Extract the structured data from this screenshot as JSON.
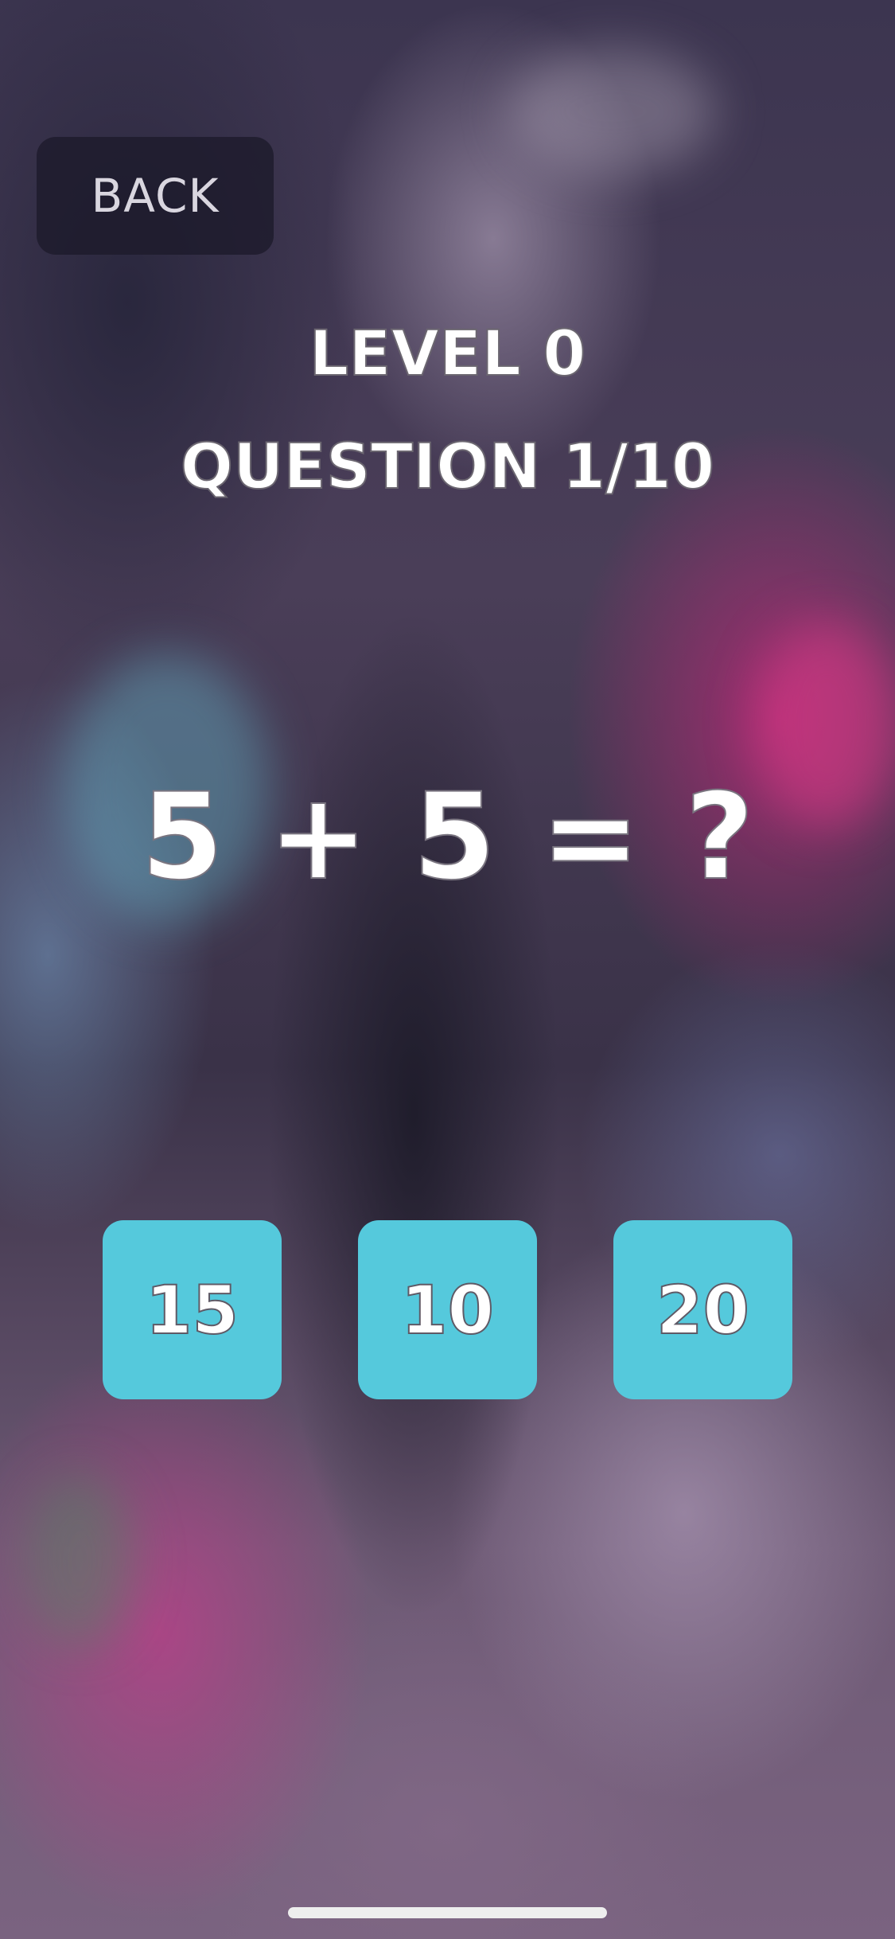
{
  "header": {
    "back_label": "BACK"
  },
  "quiz": {
    "level": "LEVEL 0",
    "question": "QUESTION 1/10",
    "equation": {
      "left": "5",
      "operator": "+",
      "right": "5",
      "equals": "=",
      "unknown": "?"
    },
    "answers": [
      "15",
      "10",
      "20"
    ]
  },
  "colors": {
    "answer_button": "#55c9dc",
    "back_button": "#1c1a2a",
    "text": "#ffffff"
  }
}
